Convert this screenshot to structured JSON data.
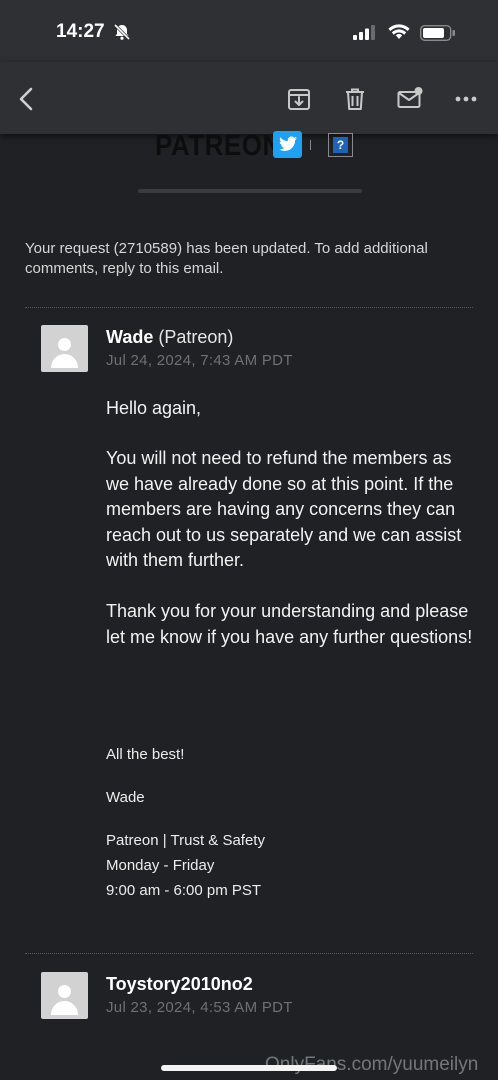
{
  "status_bar": {
    "time": "14:27"
  },
  "toolbar": {
    "icons": [
      "back-chevron-icon",
      "archive-icon",
      "trash-icon",
      "mail-unread-icon",
      "more-icon"
    ]
  },
  "header": {
    "brand": "PATREON",
    "help_glyph": "?"
  },
  "notice": "Your request (2710589) has been updated. To add additional comments, reply to this email.",
  "messages": [
    {
      "sender_name": "Wade",
      "sender_org": "(Patreon)",
      "date": "Jul 24, 2024, 7:43 AM PDT",
      "greeting": "Hello again,",
      "paragraph_1": "You will not need to refund the members as we have already done so at this point. If the members are having any concerns they can reach out to us separately and we can assist with them further.",
      "paragraph_2": "Thank you for your understanding and please let me know if you have any further questions!",
      "closing": "All the best!",
      "signature_name": "Wade",
      "signature_lines": [
        "Patreon | Trust & Safety",
        "Monday - Friday",
        "9:00 am - 6:00 pm PST"
      ]
    },
    {
      "sender_name": "Toystory2010no2",
      "date": "Jul 23, 2024, 4:53 AM PDT"
    }
  ],
  "watermark": "OnlyFans.com/yuumeilyn"
}
